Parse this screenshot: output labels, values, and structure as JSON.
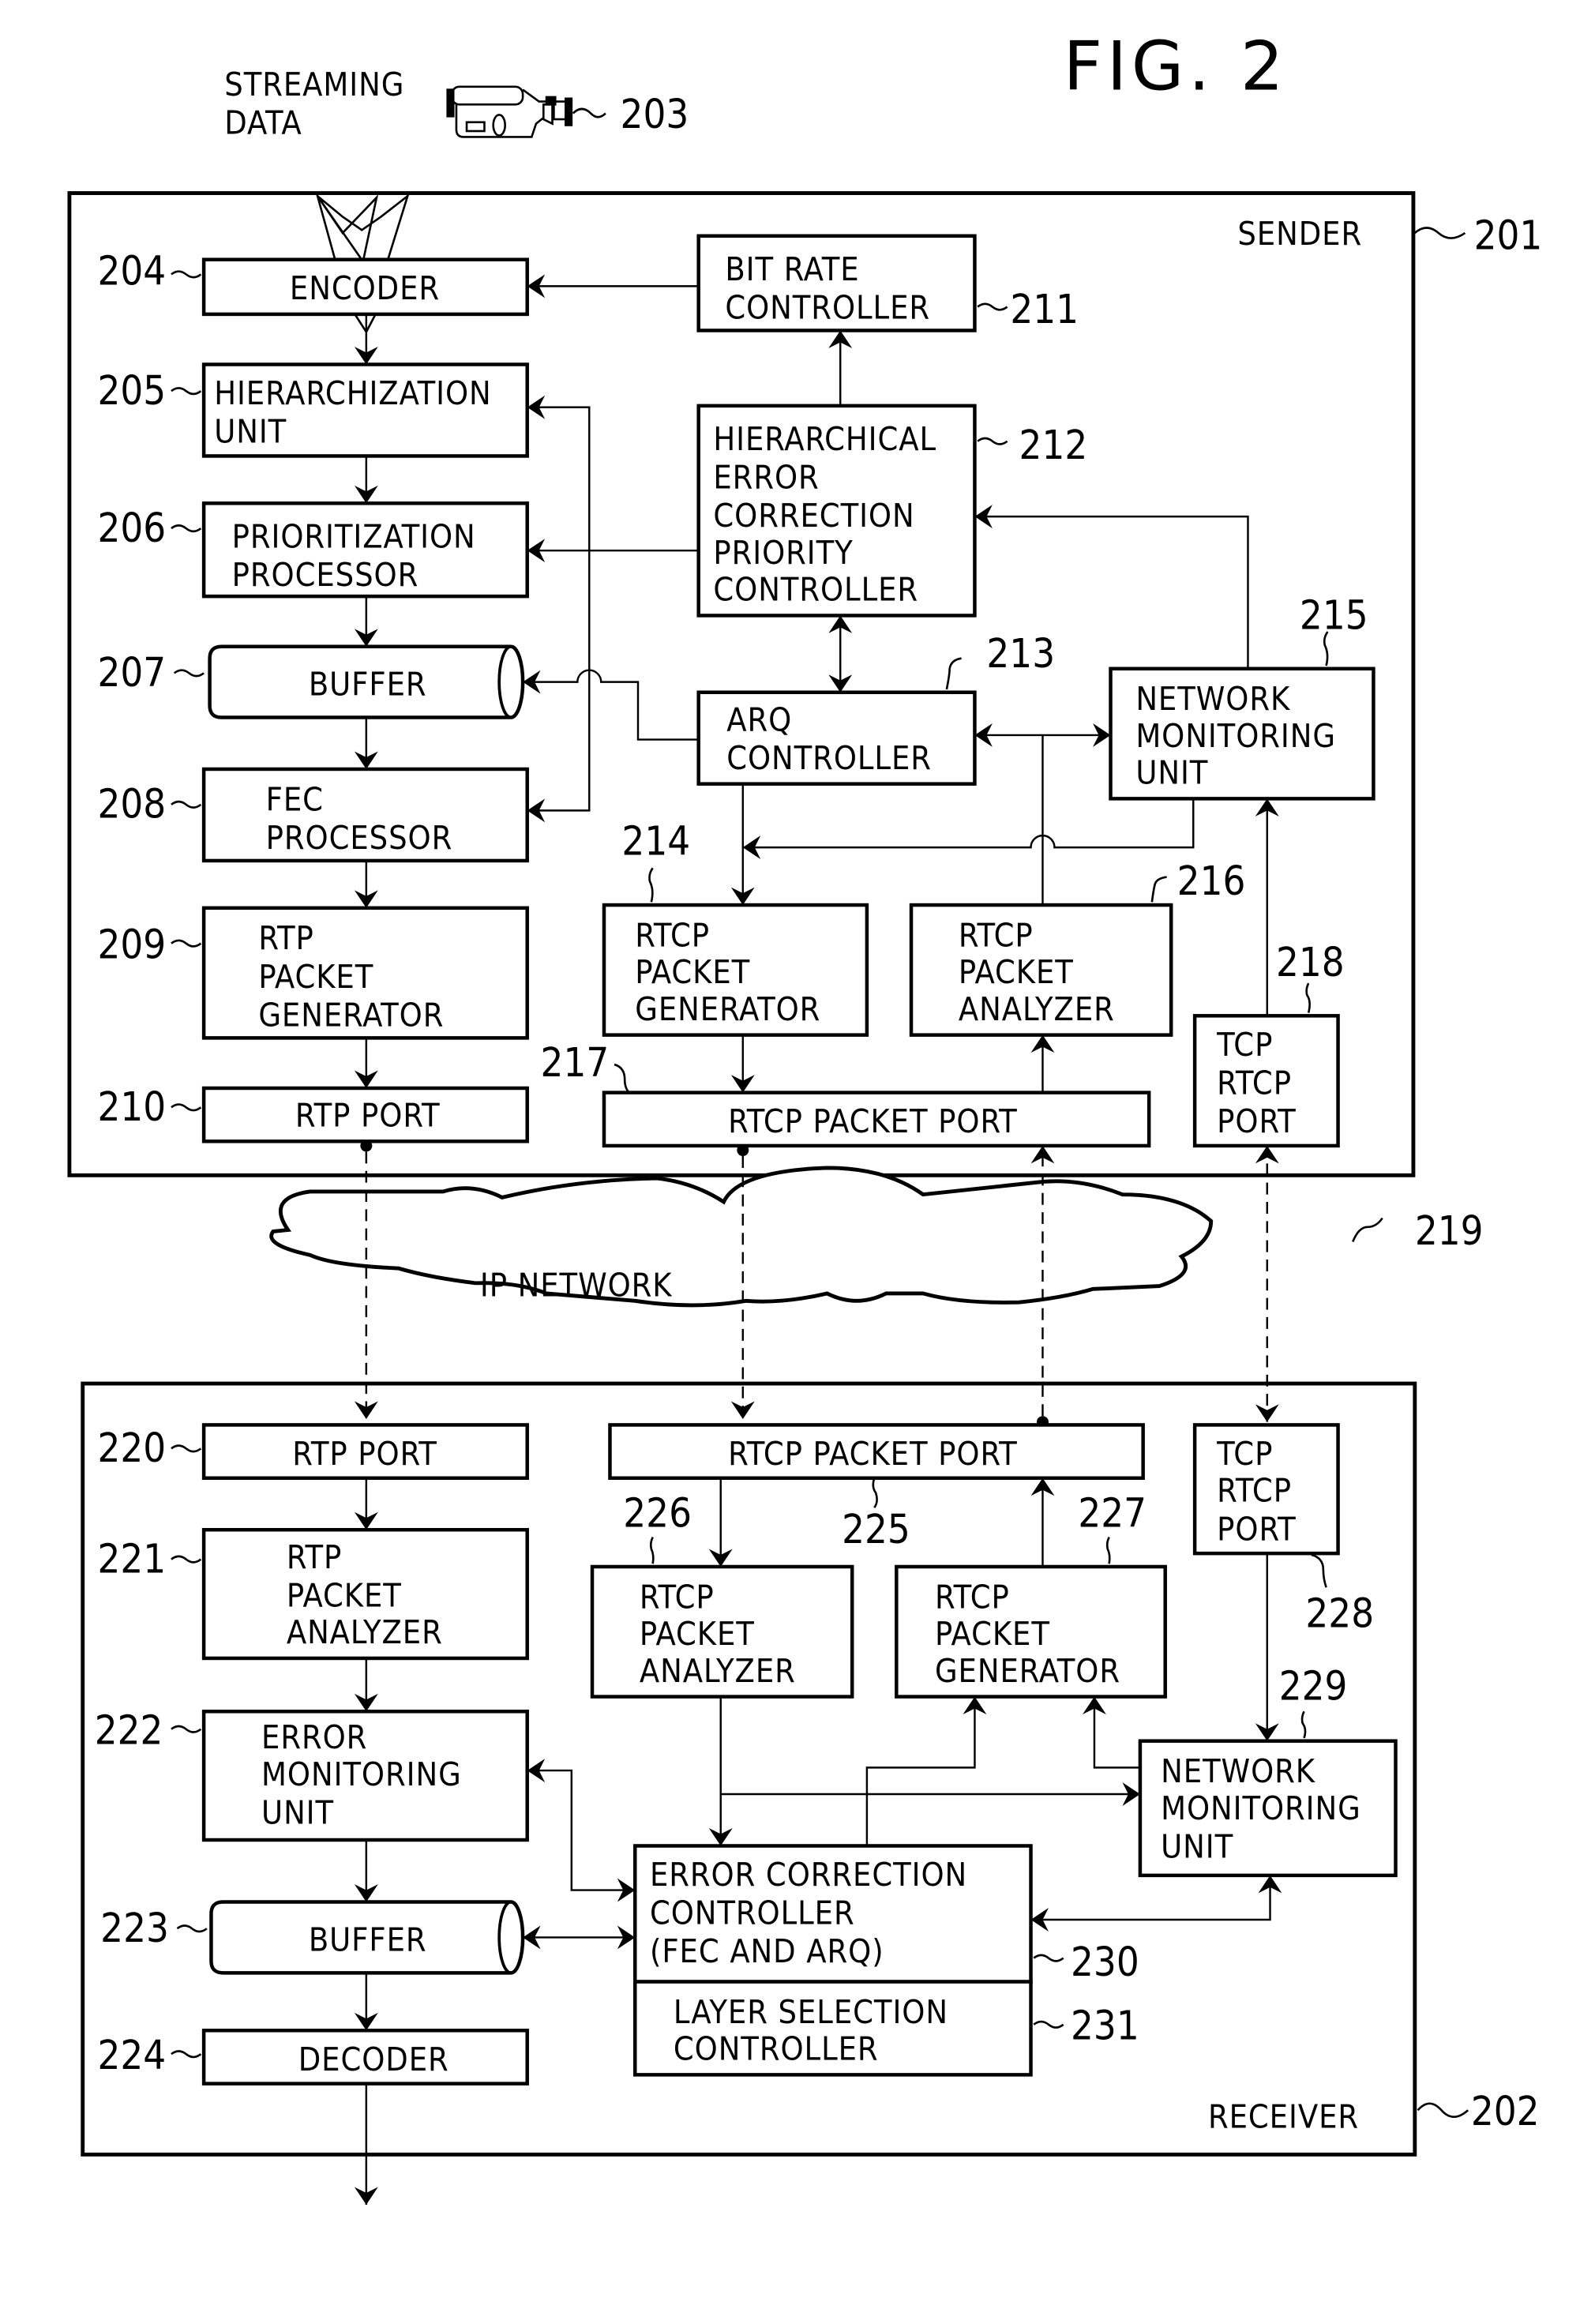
{
  "figure": {
    "title": "FIG. 2",
    "input_label": [
      "STREAMING",
      "DATA"
    ],
    "camera_ref": "203",
    "network": {
      "label": "IP NETWORK",
      "ref": "219"
    }
  },
  "sender": {
    "label": "SENDER",
    "ref": "201",
    "blocks": {
      "encoder": {
        "ref": "204",
        "lines": [
          "ENCODER"
        ]
      },
      "hierarchization": {
        "ref": "205",
        "lines": [
          "HIERARCHIZATION",
          "UNIT"
        ]
      },
      "prioritization": {
        "ref": "206",
        "lines": [
          "PRIORITIZATION",
          "PROCESSOR"
        ]
      },
      "buffer": {
        "ref": "207",
        "lines": [
          "BUFFER"
        ]
      },
      "fec": {
        "ref": "208",
        "lines": [
          "FEC",
          "PROCESSOR"
        ]
      },
      "rtp_gen": {
        "ref": "209",
        "lines": [
          "RTP",
          "PACKET",
          "GENERATOR"
        ]
      },
      "rtp_port": {
        "ref": "210",
        "lines": [
          "RTP  PORT"
        ]
      },
      "bitrate": {
        "ref": "211",
        "lines": [
          "BIT  RATE",
          "CONTROLLER"
        ]
      },
      "hec_priority": {
        "ref": "212",
        "lines": [
          "HIERARCHICAL",
          "ERROR",
          "CORRECTION",
          "PRIORITY",
          "CONTROLLER"
        ]
      },
      "arq": {
        "ref": "213",
        "lines": [
          "ARQ",
          "CONTROLLER"
        ]
      },
      "rtcp_gen": {
        "ref": "214",
        "lines": [
          "RTCP",
          "PACKET",
          "GENERATOR"
        ]
      },
      "net_mon": {
        "ref": "215",
        "lines": [
          "NETWORK",
          "MONITORING",
          "UNIT"
        ]
      },
      "rtcp_an": {
        "ref": "216",
        "lines": [
          "RTCP",
          "PACKET",
          "ANALYZER"
        ]
      },
      "rtcp_port": {
        "ref": "217",
        "lines": [
          "RTCP  PACKET  PORT"
        ]
      },
      "tcp_port": {
        "ref": "218",
        "lines": [
          "TCP",
          "RTCP",
          "PORT"
        ]
      }
    }
  },
  "receiver": {
    "label": "RECEIVER",
    "ref": "202",
    "blocks": {
      "rtp_port": {
        "ref": "220",
        "lines": [
          "RTP  PORT"
        ]
      },
      "rtp_an": {
        "ref": "221",
        "lines": [
          "RTP",
          "PACKET",
          "ANALYZER"
        ]
      },
      "err_mon": {
        "ref": "222",
        "lines": [
          "ERROR",
          "MONITORING",
          "UNIT"
        ]
      },
      "buffer": {
        "ref": "223",
        "lines": [
          "BUFFER"
        ]
      },
      "decoder": {
        "ref": "224",
        "lines": [
          "DECODER"
        ]
      },
      "rtcp_port": {
        "ref": "225",
        "lines": [
          "RTCP  PACKET  PORT"
        ]
      },
      "rtcp_an": {
        "ref": "226",
        "lines": [
          "RTCP",
          "PACKET",
          "ANALYZER"
        ]
      },
      "rtcp_gen": {
        "ref": "227",
        "lines": [
          "RTCP",
          "PACKET",
          "GENERATOR"
        ]
      },
      "tcp_port": {
        "ref": "228",
        "lines": [
          "TCP",
          "RTCP",
          "PORT"
        ]
      },
      "net_mon": {
        "ref": "229",
        "lines": [
          "NETWORK",
          "MONITORING",
          "UNIT"
        ]
      },
      "ec_ctrl": {
        "ref": "230",
        "lines": [
          "ERROR  CORRECTION",
          "CONTROLLER",
          "(FEC  AND  ARQ)"
        ]
      },
      "layer_sel": {
        "ref": "231",
        "lines": [
          "LAYER  SELECTION",
          "CONTROLLER"
        ]
      }
    }
  }
}
